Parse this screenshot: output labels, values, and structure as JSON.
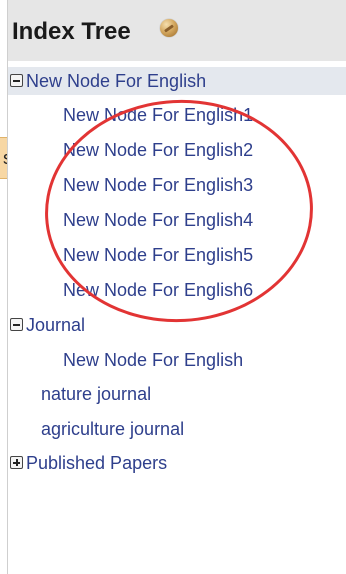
{
  "panel": {
    "title": "Index Tree",
    "help_icon": "help-icon"
  },
  "tree": {
    "root1": {
      "label": "New Node For English",
      "expanded": true,
      "children": [
        "New Node For English1",
        "New Node For English2",
        "New Node For English3",
        "New Node For English4",
        "New Node For English5",
        "New Node For English6"
      ]
    },
    "root2": {
      "label": "Journal",
      "expanded": true,
      "children": [
        "New Node For English"
      ]
    },
    "top_level": [
      "nature journal",
      "agriculture journal"
    ],
    "root3": {
      "label": "Published Papers",
      "expanded": false
    }
  },
  "callout": {
    "text": "s"
  },
  "colors": {
    "link": "#2e3f8c",
    "header_bg": "#e6e6e6",
    "selected_bg": "#e4e8ee",
    "annotation": "#e23434",
    "callout_bg": "#f7d7a4"
  }
}
